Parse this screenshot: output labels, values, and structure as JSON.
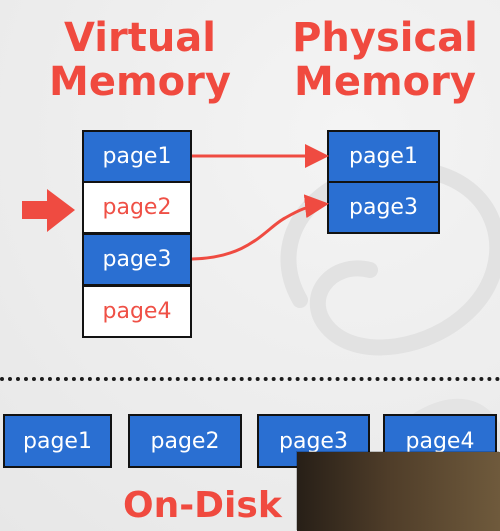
{
  "virtual_memory": {
    "title": "Virtual\nMemory",
    "pages": [
      {
        "label": "page1",
        "loaded": true
      },
      {
        "label": "page2",
        "loaded": false
      },
      {
        "label": "page3",
        "loaded": true
      },
      {
        "label": "page4",
        "loaded": false
      }
    ]
  },
  "physical_memory": {
    "title": "Physical\nMemory",
    "pages": [
      {
        "label": "page1"
      },
      {
        "label": "page3"
      }
    ]
  },
  "on_disk": {
    "label": "On-Disk",
    "pages": [
      {
        "label": "page1"
      },
      {
        "label": "page2"
      },
      {
        "label": "page3"
      },
      {
        "label": "page4"
      }
    ]
  },
  "mappings": [
    {
      "from": "page1",
      "to": "page1"
    },
    {
      "from": "page3",
      "to": "page3"
    }
  ],
  "colors": {
    "title": "#f04a3f",
    "loaded_fill": "#2a6fd2",
    "empty_text": "#ef5046",
    "arrow": "#ef4b41",
    "border": "#121212"
  }
}
